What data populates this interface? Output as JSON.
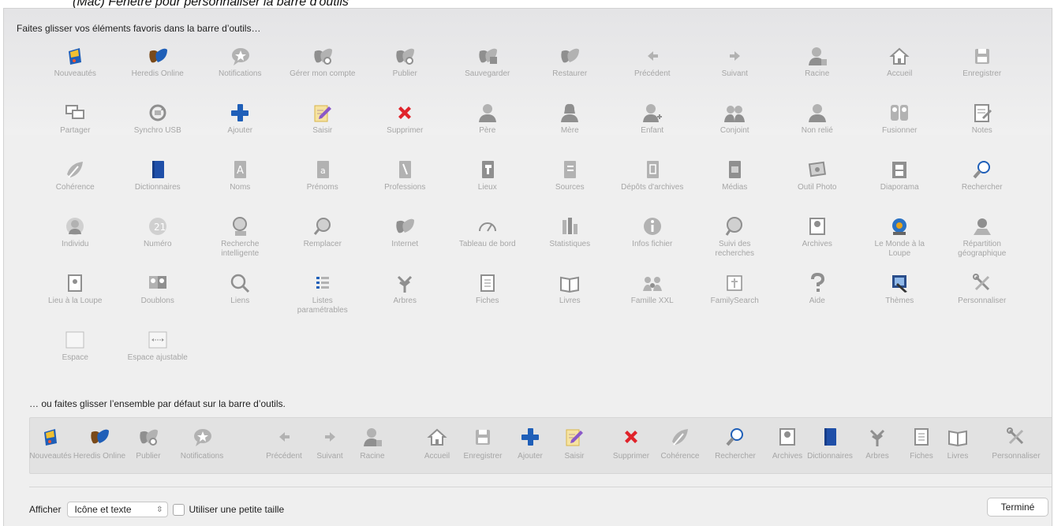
{
  "doc_title": "(Mac) Fenêtre pour personnaliser la barre d'outils",
  "instructions": {
    "top": "Faites glisser vos éléments favoris dans la barre d’outils…",
    "bottom": "… ou faites glisser l’ensemble par défaut sur la barre d’outils."
  },
  "items": [
    {
      "label": "Nouveautés",
      "icon": "nouveautes"
    },
    {
      "label": "Heredis Online",
      "icon": "leaf-color"
    },
    {
      "label": "Notifications",
      "icon": "bubble-star"
    },
    {
      "label": "Gérer mon compte",
      "icon": "leaf-gear"
    },
    {
      "label": "Publier",
      "icon": "leaf-gear"
    },
    {
      "label": "Sauvegarder",
      "icon": "leaf-save"
    },
    {
      "label": "Restaurer",
      "icon": "leaf-gray"
    },
    {
      "label": "Précédent",
      "icon": "arrow-left"
    },
    {
      "label": "Suivant",
      "icon": "arrow-right"
    },
    {
      "label": "Racine",
      "icon": "person-root"
    },
    {
      "label": "Accueil",
      "icon": "house"
    },
    {
      "label": "Enregistrer",
      "icon": "floppy"
    },
    {
      "label": "Partager",
      "icon": "screens"
    },
    {
      "label": "Synchro USB",
      "icon": "sync"
    },
    {
      "label": "Ajouter",
      "icon": "plus"
    },
    {
      "label": "Saisir",
      "icon": "pad-pencil"
    },
    {
      "label": "Supprimer",
      "icon": "red-x"
    },
    {
      "label": "Père",
      "icon": "person"
    },
    {
      "label": "Mère",
      "icon": "person-f"
    },
    {
      "label": "Enfant",
      "icon": "person-plus"
    },
    {
      "label": "Conjoint",
      "icon": "couple"
    },
    {
      "label": "Non relié",
      "icon": "person"
    },
    {
      "label": "Fusionner",
      "icon": "merge"
    },
    {
      "label": "Notes",
      "icon": "notes"
    },
    {
      "label": "Cohérence",
      "icon": "leaf-check"
    },
    {
      "label": "Dictionnaires",
      "icon": "book-blue"
    },
    {
      "label": "Noms",
      "icon": "book-a"
    },
    {
      "label": "Prénoms",
      "icon": "book-a-small"
    },
    {
      "label": "Professions",
      "icon": "book-tools"
    },
    {
      "label": "Lieux",
      "icon": "book-pin"
    },
    {
      "label": "Sources",
      "icon": "book-doc"
    },
    {
      "label": "Dépôts d'archives",
      "icon": "book-bin"
    },
    {
      "label": "Médias",
      "icon": "book-media"
    },
    {
      "label": "Outil Photo",
      "icon": "photo"
    },
    {
      "label": "Diaporama",
      "icon": "film"
    },
    {
      "label": "Rechercher",
      "icon": "magnifier-blue"
    },
    {
      "label": "Individu",
      "icon": "person-circle"
    },
    {
      "label": "Numéro",
      "icon": "number"
    },
    {
      "label": "Recherche intelligente",
      "icon": "search-person"
    },
    {
      "label": "Remplacer",
      "icon": "replace"
    },
    {
      "label": "Internet",
      "icon": "leaf-gray"
    },
    {
      "label": "Tableau de bord",
      "icon": "gauge"
    },
    {
      "label": "Statistiques",
      "icon": "stats"
    },
    {
      "label": "Infos fichier",
      "icon": "info"
    },
    {
      "label": "Suivi des recherches",
      "icon": "search-track"
    },
    {
      "label": "Archives",
      "icon": "archives"
    },
    {
      "label": "Le Monde à la Loupe",
      "icon": "globe-loupe"
    },
    {
      "label": "Répartition géographique",
      "icon": "map-person"
    },
    {
      "label": "Lieu à la Loupe",
      "icon": "place-loupe"
    },
    {
      "label": "Doublons",
      "icon": "duplicates"
    },
    {
      "label": "Liens",
      "icon": "links"
    },
    {
      "label": "Listes paramétrables",
      "icon": "lists"
    },
    {
      "label": "Arbres",
      "icon": "tree"
    },
    {
      "label": "Fiches",
      "icon": "cards"
    },
    {
      "label": "Livres",
      "icon": "open-book"
    },
    {
      "label": "Famille XXL",
      "icon": "family"
    },
    {
      "label": "FamilySearch",
      "icon": "familysearch"
    },
    {
      "label": "Aide",
      "icon": "question"
    },
    {
      "label": "Thèmes",
      "icon": "themes"
    },
    {
      "label": "Personnaliser",
      "icon": "tools"
    },
    {
      "label": "Espace",
      "icon": "space"
    },
    {
      "label": "Espace ajustable",
      "icon": "flex-space"
    }
  ],
  "default_set": [
    {
      "label": "Nouveautés",
      "icon": "nouveautes"
    },
    {
      "label": "Heredis Online",
      "icon": "leaf-color"
    },
    {
      "label": "Publier",
      "icon": "leaf-gear"
    },
    {
      "label": "Notifications",
      "icon": "bubble-star"
    },
    {
      "label": "Précédent",
      "icon": "arrow-left"
    },
    {
      "label": "Suivant",
      "icon": "arrow-right"
    },
    {
      "label": "Racine",
      "icon": "person-root"
    },
    {
      "label": "Accueil",
      "icon": "house"
    },
    {
      "label": "Enregistrer",
      "icon": "floppy"
    },
    {
      "label": "Ajouter",
      "icon": "plus"
    },
    {
      "label": "Saisir",
      "icon": "pad-pencil"
    },
    {
      "label": "Supprimer",
      "icon": "red-x"
    },
    {
      "label": "Cohérence",
      "icon": "leaf-check"
    },
    {
      "label": "Rechercher",
      "icon": "magnifier-blue"
    },
    {
      "label": "Archives",
      "icon": "archives"
    },
    {
      "label": "Dictionnaires",
      "icon": "book-blue"
    },
    {
      "label": "Arbres",
      "icon": "tree"
    },
    {
      "label": "Fiches",
      "icon": "cards"
    },
    {
      "label": "Livres",
      "icon": "open-book"
    },
    {
      "label": "Personnaliser",
      "icon": "tools"
    }
  ],
  "controls": {
    "show_label": "Afficher",
    "show_value": "Icône et texte",
    "small_size_label": "Utiliser une petite taille",
    "small_size_checked": false,
    "done_label": "Terminé"
  },
  "colors": {
    "sheet_bg": "#efefef",
    "label_gray": "#a6a6a6",
    "accent_blue": "#1f5fb8",
    "delete_red": "#e0232a",
    "leaf_orange": "#e5a21b"
  }
}
